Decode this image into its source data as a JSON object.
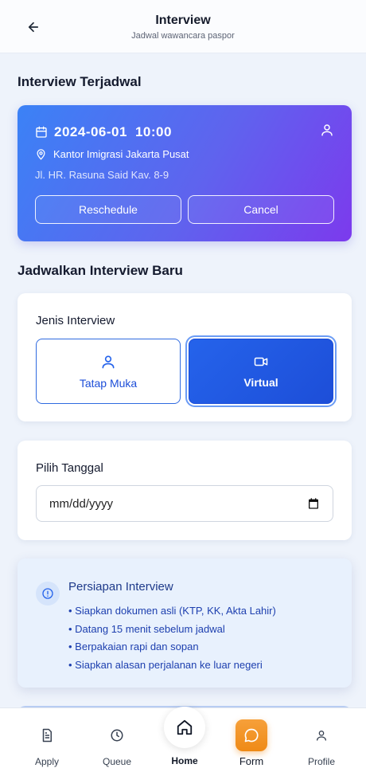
{
  "header": {
    "title": "Interview",
    "subtitle": "Jadwal wawancara paspor",
    "back_icon": "arrow-left-icon"
  },
  "scheduled": {
    "section_title": "Interview Terjadwal",
    "date": "2024-06-01",
    "time": "10:00",
    "location": "Kantor Imigrasi Jakarta Pusat",
    "address": "Jl. HR. Rasuna Said Kav. 8-9",
    "reschedule_label": "Reschedule",
    "cancel_label": "Cancel",
    "gradient": [
      "#3b82f6",
      "#7c3aed"
    ]
  },
  "new_schedule": {
    "section_title": "Jadwalkan Interview Baru",
    "type_label": "Jenis Interview",
    "options": [
      {
        "label": "Tatap Muka",
        "icon": "user-icon",
        "selected": false
      },
      {
        "label": "Virtual",
        "icon": "video-icon",
        "selected": true
      }
    ],
    "date_label": "Pilih Tanggal",
    "date_placeholder": "mm/dd/yyyy"
  },
  "preparation": {
    "title": "Persiapan Interview",
    "items": [
      "• Siapkan dokumen asli (KTP, KK, Akta Lahir)",
      "• Datang 15 menit sebelum jadwal",
      "• Berpakaian rapi dan sopan",
      "• Siapkan alasan perjalanan ke luar negeri"
    ]
  },
  "bottom_nav": {
    "items": [
      {
        "label": "Apply",
        "icon": "document-icon"
      },
      {
        "label": "Queue",
        "icon": "clock-icon"
      },
      {
        "label": "Home",
        "icon": "home-icon"
      },
      {
        "label": "Form",
        "icon": "chat-icon"
      },
      {
        "label": "Profile",
        "icon": "user-icon"
      }
    ],
    "accent": "#ef8a16"
  },
  "colors": {
    "primary": "#2563eb",
    "background": "#eef3fb"
  }
}
